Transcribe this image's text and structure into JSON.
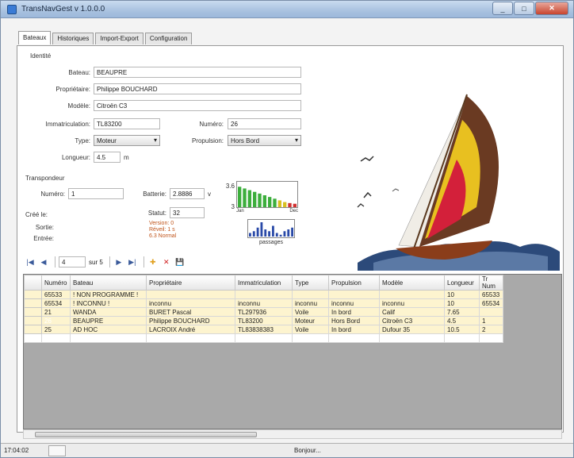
{
  "window": {
    "title": "TransNavGest  v 1.0.0.0",
    "minimize": "_",
    "maximize": "□",
    "close": "✕"
  },
  "tabs": [
    "Bateaux",
    "Historiques",
    "Import-Export",
    "Configuration"
  ],
  "identite": {
    "group_label": "Identité",
    "bateau_label": "Bateau:",
    "bateau": "BEAUPRE",
    "proprietaire_label": "Propriétaire:",
    "proprietaire": "Philippe BOUCHARD",
    "modele_label": "Modèle:",
    "modele": "Citroën C3",
    "immat_label": "Immatriculation:",
    "immat": "TL83200",
    "numero_label": "Numéro:",
    "numero": "26",
    "type_label": "Type:",
    "type": "Moteur",
    "propulsion_label": "Propulsion:",
    "propulsion": "Hors Bord",
    "longueur_label": "Longueur:",
    "longueur": "4.5",
    "longueur_unit": "m"
  },
  "transpondeur": {
    "group_label": "Transpondeur",
    "numero_label": "Numéro:",
    "numero": "1",
    "batterie_label": "Batterie:",
    "batterie": "2.8886",
    "batterie_unit": "v",
    "cree_label": "Créé le:",
    "statut_label": "Statut:",
    "statut": "32",
    "sortie_label": "Sortie:",
    "entree_label": "Entrée:",
    "status_line1": "Version:   0",
    "status_line2": "Réveil:     1 s",
    "status_line3": "6.3        Normal",
    "passages_label": "passages"
  },
  "battery_chart": {
    "y_top": "3.6",
    "y_low": "3",
    "x_start": "Jan",
    "x_end": "Dec",
    "values": [
      3.5,
      3.45,
      3.4,
      3.35,
      3.3,
      3.25,
      3.2,
      3.15,
      3.1,
      3.05,
      3.02,
      3.0
    ]
  },
  "passages_chart": {
    "values": [
      2,
      3,
      5,
      8,
      4,
      3,
      6,
      2,
      1,
      3,
      4,
      5
    ]
  },
  "navigator": {
    "first": "|◀",
    "prev": "◀",
    "position": "4",
    "of": "sur 5",
    "next": "▶",
    "last": "▶|",
    "add": "✚",
    "delete": "✕",
    "save": "💾"
  },
  "grid": {
    "columns": [
      "Numéro",
      "Bateau",
      "Propriétaire",
      "Immatriculation",
      "Type",
      "Propulsion",
      "Modèle",
      "Longueur",
      "Tr Num"
    ],
    "rows": [
      [
        "65533",
        "! NON PROGRAMME !",
        "",
        "",
        "",
        "",
        "",
        "10",
        "65533"
      ],
      [
        "65534",
        "! INCONNU !",
        "inconnu",
        "inconnu",
        "inconnu",
        "inconnu",
        "inconnu",
        "10",
        "65534"
      ],
      [
        "21",
        "WANDA",
        "BURET Pascal",
        "TL297936",
        "Voile",
        "In bord",
        "Calif",
        "7.65",
        ""
      ],
      [
        "26",
        "BEAUPRE",
        "Philippe BOUCHARD",
        "TL83200",
        "Moteur",
        "Hors Bord",
        "Citroën C3",
        "4.5",
        "1"
      ],
      [
        "25",
        "AD HOC",
        "LACROIX André",
        "TL83838383",
        "Voile",
        "In bord",
        "Dufour 35",
        "10.5",
        "2"
      ]
    ]
  },
  "statusbar": {
    "time": "17:04:02",
    "message": "Bonjour..."
  },
  "colors": {
    "accent": "#3875d7",
    "highlight_row": "#fdf4cf",
    "status_orange": "#c0541a"
  }
}
